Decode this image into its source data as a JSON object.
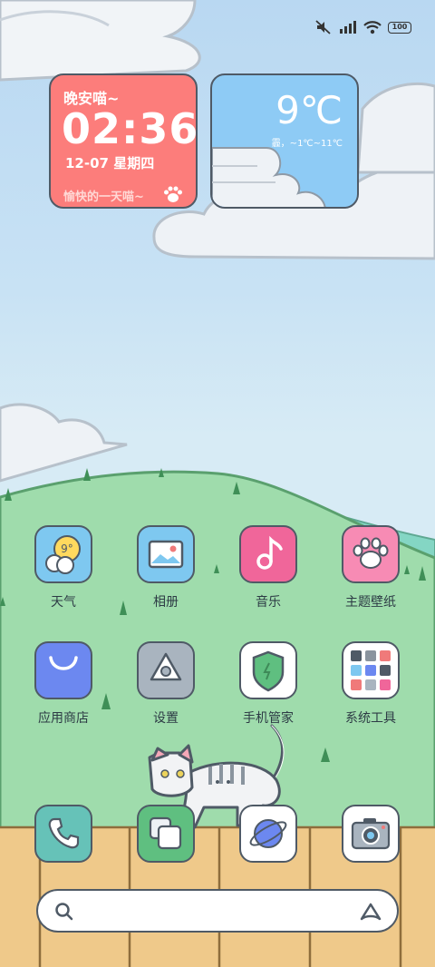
{
  "status_bar": {
    "icons": [
      "mute-icon",
      "signal-icon",
      "wifi-icon",
      "battery-icon"
    ],
    "battery": "100"
  },
  "clock_widget": {
    "greeting": "晚安喵~",
    "time": "02:36",
    "date": "12-07  星期四",
    "motto": "愉快的一天喵~",
    "icon": "paw-icon",
    "background": "#fc7d7b"
  },
  "weather_widget": {
    "temperature": "9℃",
    "description": "霾，~1℃~11℃",
    "background": "#8ecbf5"
  },
  "apps": [
    {
      "label": "天气",
      "icon": "weather-icon",
      "color": "#7ec8f0"
    },
    {
      "label": "相册",
      "icon": "gallery-icon",
      "color": "#7ec8f0"
    },
    {
      "label": "音乐",
      "icon": "music-icon",
      "color": "#f0669a"
    },
    {
      "label": "主题壁纸",
      "icon": "theme-paw-icon",
      "color": "#f78bb4"
    },
    {
      "label": "应用商店",
      "icon": "store-bag-icon",
      "color": "#6c88f0"
    },
    {
      "label": "设置",
      "icon": "settings-icon",
      "color": "#a9b4bf"
    },
    {
      "label": "手机管家",
      "icon": "security-shield-icon",
      "color": "#ffffff"
    },
    {
      "label": "系统工具",
      "icon": "system-tools-folder-icon",
      "color": "#ffffff"
    }
  ],
  "dock": [
    {
      "icon": "phone-icon",
      "color": "#66c2b8"
    },
    {
      "icon": "messages-icon",
      "color": "#5fbf80"
    },
    {
      "icon": "browser-planet-icon",
      "color": "#ffffff"
    },
    {
      "icon": "camera-icon",
      "color": "#ffffff"
    }
  ],
  "search_bar": {
    "icons": [
      "search-icon",
      "assistant-icon"
    ]
  }
}
